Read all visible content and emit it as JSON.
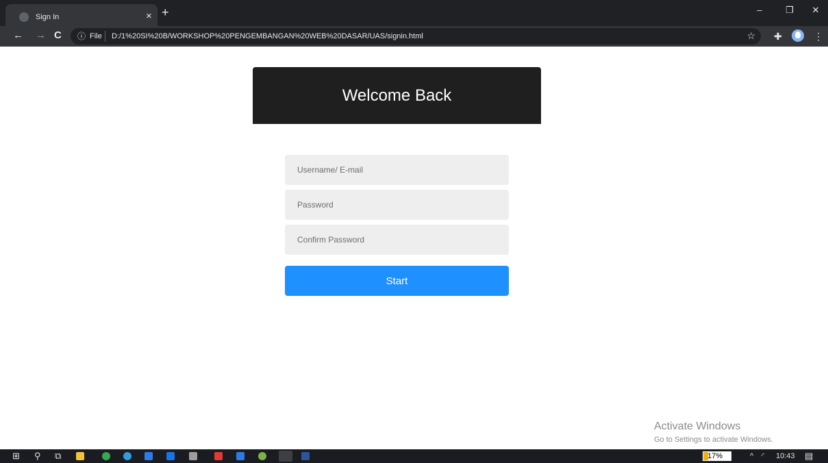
{
  "browser": {
    "tab_title": "Sign In",
    "tab_close": "×",
    "new_tab": "+",
    "window_controls": {
      "minimize": "–",
      "restore": "❐",
      "close": "✕"
    },
    "nav": {
      "back": "←",
      "forward": "→",
      "reload": "C"
    },
    "address": {
      "info_icon": "ⓘ",
      "scheme_label": "File",
      "url": "D:/1%20SI%20B/WORKSHOP%20PENGEMBANGAN%20WEB%20DASAR/UAS/signin.html"
    },
    "toolbar_icons": {
      "bookmark": "☆",
      "extensions": "✚",
      "menu": "⋮"
    }
  },
  "form": {
    "heading": "Welcome Back",
    "username_placeholder": "Username/ E-mail",
    "password_placeholder": "Password",
    "confirm_placeholder": "Confirm Password",
    "submit_label": "Start"
  },
  "watermark": {
    "title": "Activate Windows",
    "subtitle": "Go to Settings to activate Windows."
  },
  "taskbar": {
    "battery_percent": 17,
    "battery_label": "17%",
    "tray_chevron": "^",
    "wifi_icon": "◜",
    "time": "10:43",
    "notification_icon": "▤",
    "colors": {
      "blue": "#2d7be5",
      "yellow": "#f2c33a",
      "green": "#34a853",
      "red": "#e53935",
      "word": "#2b579a"
    }
  }
}
